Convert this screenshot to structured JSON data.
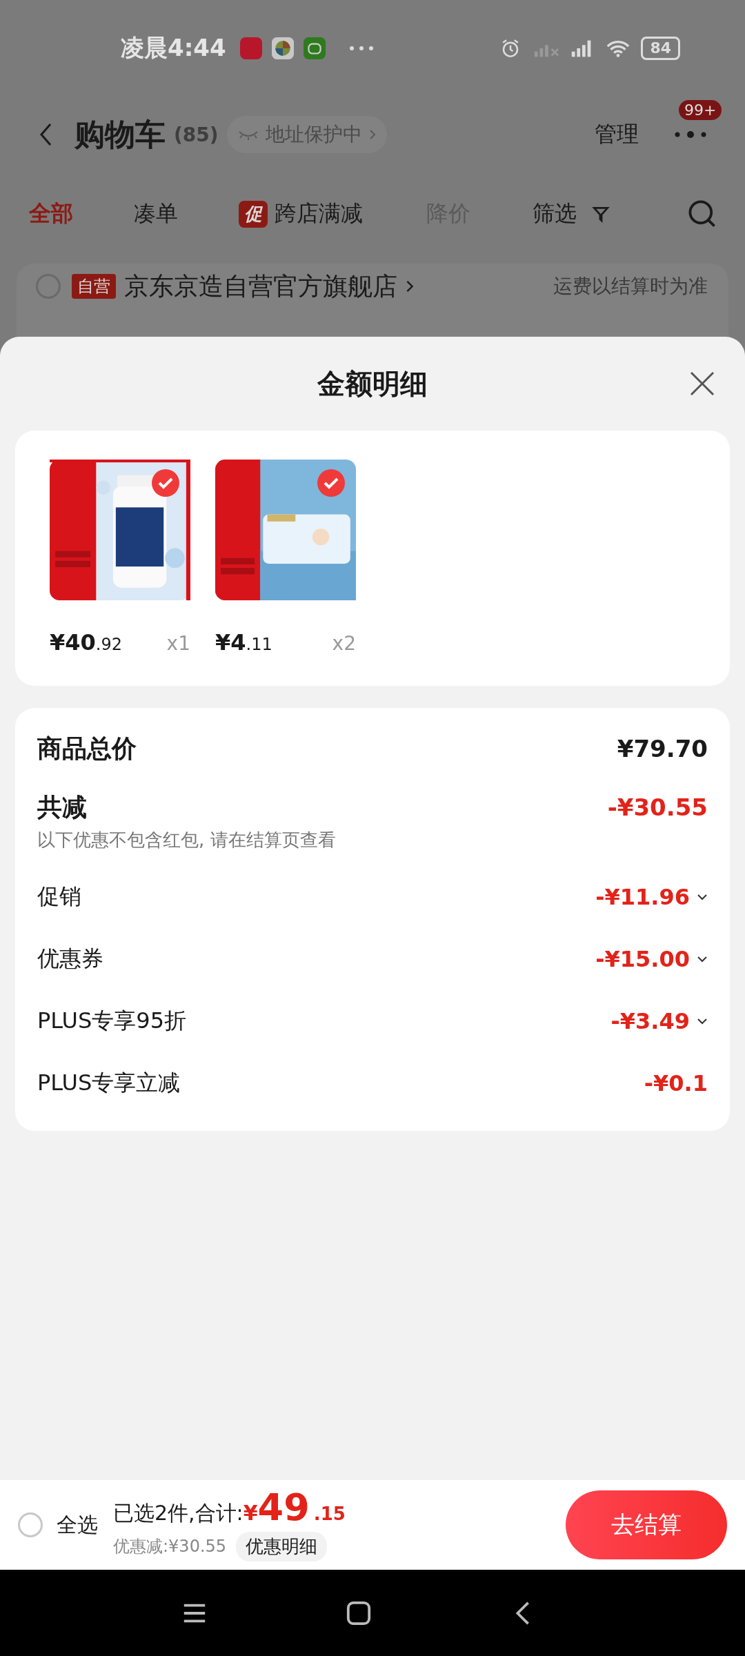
{
  "status_bar": {
    "time": "凌晨4:44",
    "battery": "84"
  },
  "header": {
    "title": "购物车",
    "count": "(85)",
    "address_badge": "地址保护中",
    "manage": "管理",
    "badge": "99+"
  },
  "tabs": [
    {
      "label": "全部",
      "selected": true,
      "disabled": false,
      "kind": "plain"
    },
    {
      "label": "凑单",
      "selected": false,
      "disabled": false,
      "kind": "plain"
    },
    {
      "label": "跨店满减",
      "tag": "促",
      "selected": false,
      "disabled": false,
      "kind": "promo"
    },
    {
      "label": "降价",
      "selected": false,
      "disabled": true,
      "kind": "plain"
    },
    {
      "label": "筛选",
      "selected": false,
      "disabled": false,
      "kind": "filter"
    }
  ],
  "store": {
    "checked": false,
    "tag": "自营",
    "name": "京东京造自营官方旗舰店",
    "note": "运费以结算时为准"
  },
  "sheet": {
    "title": "金额明细",
    "products": [
      {
        "kind": "picture",
        "selected": true,
        "price_main": "¥40",
        "price_fraction": ".92",
        "quantity": "x1"
      },
      {
        "kind": "picture",
        "selected": true,
        "price_main": "¥4",
        "price_fraction": ".11",
        "quantity": "x2"
      }
    ],
    "total": {
      "label": "商品总价",
      "value": "¥79.70"
    },
    "reduction": {
      "label": "共减",
      "value": "-¥30.55",
      "note": "以下优惠不包含红包, 请在结算页查看"
    },
    "discounts": [
      {
        "label": "促销",
        "value": "-¥11.96",
        "expandable": true
      },
      {
        "label": "优惠券",
        "value": "-¥15.00",
        "expandable": true
      },
      {
        "label": "PLUS专享95折",
        "value": "-¥3.49",
        "expandable": true
      },
      {
        "label": "PLUS专享立减",
        "value": "-¥0.1",
        "expandable": false
      }
    ]
  },
  "bottom_bar": {
    "select_all": {
      "label": "全选",
      "checked": false
    },
    "summary": "已选2件,合计:",
    "currency": "¥",
    "total_main": "49",
    "total_fraction": ".15",
    "discount": "优惠减:¥30.55",
    "detail_button": "优惠明细",
    "checkout": "去结算"
  }
}
